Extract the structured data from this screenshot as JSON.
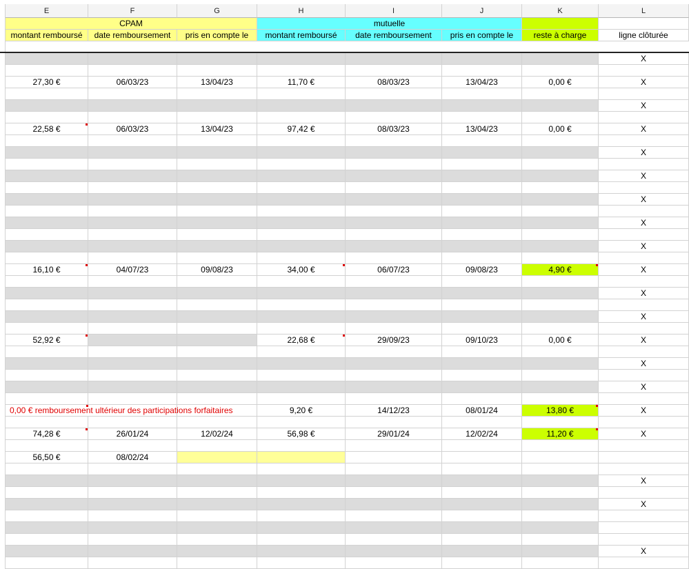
{
  "columns": [
    "E",
    "F",
    "G",
    "H",
    "I",
    "J",
    "K",
    "L"
  ],
  "groups": {
    "cpam": "CPAM",
    "mutuelle": "mutuelle"
  },
  "headers": [
    "montant remboursé",
    "date remboursement",
    "pris en compte le",
    "montant remboursé",
    "date remboursement",
    "pris en compte le",
    "reste à charge",
    "ligne clôturée"
  ],
  "rows": [
    {
      "type": "gray",
      "l": "X"
    },
    {
      "type": "data",
      "e": "27,30 €",
      "f": "06/03/23",
      "g": "13/04/23",
      "h": "11,70 €",
      "i": "08/03/23",
      "j": "13/04/23",
      "k": "0,00 €",
      "l": "X"
    },
    {
      "type": "gray",
      "l": "X"
    },
    {
      "type": "data",
      "e": "22,58 €",
      "f": "06/03/23",
      "g": "13/04/23",
      "h": "97,42 €",
      "i": "08/03/23",
      "j": "13/04/23",
      "k": "0,00 €",
      "l": "X"
    },
    {
      "type": "gray",
      "l": "X"
    },
    {
      "type": "gray",
      "l": "X"
    },
    {
      "type": "gray",
      "l": "X"
    },
    {
      "type": "gray",
      "l": "X"
    },
    {
      "type": "gray",
      "l": "X"
    },
    {
      "type": "data",
      "e": "16,10 €",
      "f": "04/07/23",
      "g": "09/08/23",
      "h": "34,00 €",
      "i": "06/07/23",
      "j": "09/08/23",
      "k": "4,90 €",
      "l": "X"
    },
    {
      "type": "gray",
      "l": "X"
    },
    {
      "type": "gray",
      "l": "X"
    },
    {
      "type": "data",
      "e": "52,92 €",
      "f": "",
      "g": "",
      "h": "22,68 €",
      "i": "29/09/23",
      "j": "09/10/23",
      "k": "0,00 €",
      "l": "X"
    },
    {
      "type": "gray",
      "l": "X"
    },
    {
      "type": "gray",
      "l": "X"
    },
    {
      "type": "data",
      "e": "0,00 € remboursement ultérieur des participations forfaitaires",
      "f": "",
      "g": "",
      "h": "9,20 €",
      "i": "14/12/23",
      "j": "08/01/24",
      "k": "13,80 €",
      "l": "X"
    },
    {
      "type": "data",
      "e": "74,28 €",
      "f": "26/01/24",
      "g": "12/02/24",
      "h": "56,98 €",
      "i": "29/01/24",
      "j": "12/02/24",
      "k": "11,20 €",
      "l": "X"
    },
    {
      "type": "data",
      "e": "56,50 €",
      "f": "08/02/24",
      "g": "",
      "h": "",
      "i": "",
      "j": "",
      "k": "",
      "l": ""
    },
    {
      "type": "gray",
      "l": "X"
    },
    {
      "type": "gray",
      "l": "X"
    },
    {
      "type": "gray",
      "l": ""
    },
    {
      "type": "gray",
      "l": "X"
    }
  ]
}
